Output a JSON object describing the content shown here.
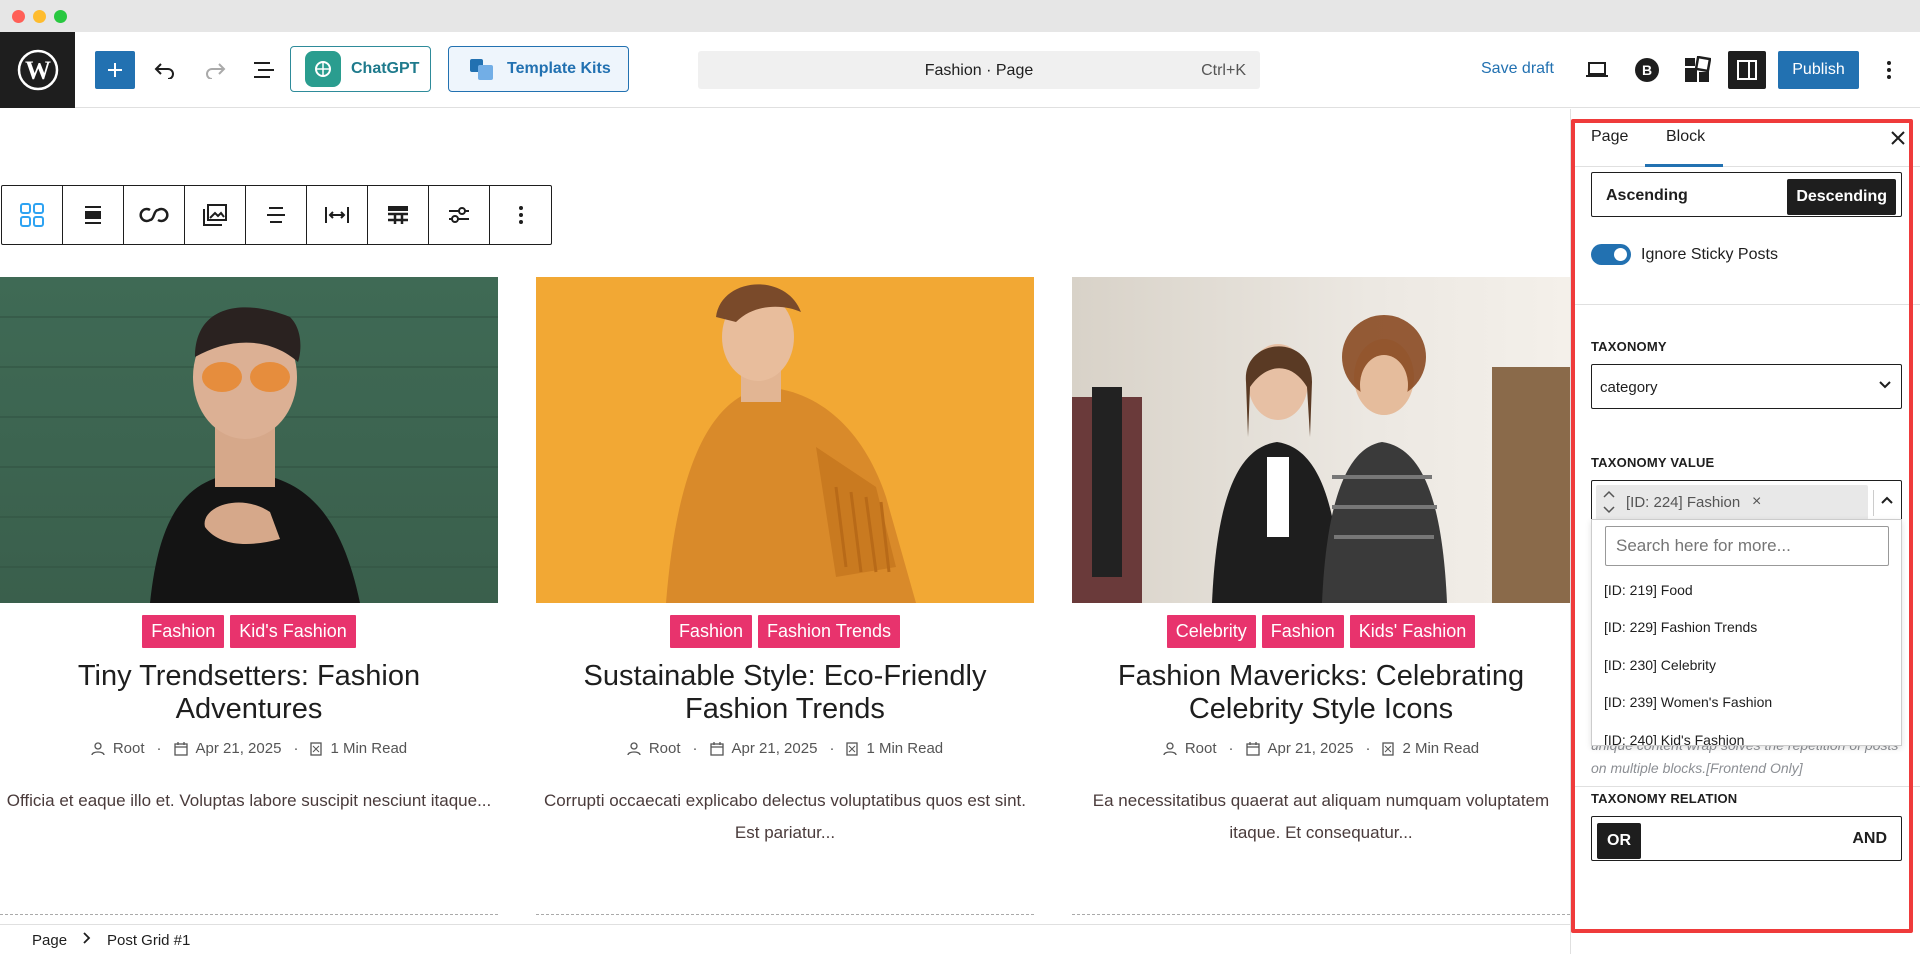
{
  "topbar": {
    "chatgpt_label": "ChatGPT",
    "template_kits_label": "Template Kits",
    "doc_title": "Fashion · Page",
    "shortcut": "Ctrl+K",
    "save_draft": "Save draft",
    "publish": "Publish"
  },
  "posts": [
    {
      "tags": [
        "Fashion",
        "Kid's Fashion"
      ],
      "title": "Tiny Trendsetters: Fashion Adventures",
      "author": "Root",
      "date": "Apr 21, 2025",
      "read": "1 Min Read",
      "excerpt": "Officia et eaque illo et. Voluptas labore suscipit nesciunt itaque..."
    },
    {
      "tags": [
        "Fashion",
        "Fashion Trends"
      ],
      "title": "Sustainable Style: Eco-Friendly Fashion Trends",
      "author": "Root",
      "date": "Apr 21, 2025",
      "read": "1 Min Read",
      "excerpt": "Corrupti occaecati explicabo delectus voluptatibus quos est sint. Est pariatur..."
    },
    {
      "tags": [
        "Celebrity",
        "Fashion",
        "Kids' Fashion"
      ],
      "title": "Fashion Mavericks: Celebrating Celebrity Style Icons",
      "author": "Root",
      "date": "Apr 21, 2025",
      "read": "2 Min Read",
      "excerpt": "Ea necessitatibus quaerat aut aliquam numquam voluptatem itaque. Et consequatur..."
    }
  ],
  "breadcrumb": [
    "Page",
    "Post Grid #1"
  ],
  "sidebar": {
    "tabs": [
      "Page",
      "Block"
    ],
    "order": {
      "ascending": "Ascending",
      "descending": "Descending"
    },
    "ignore_sticky": "Ignore Sticky Posts",
    "taxonomy_label": "TAXONOMY",
    "taxonomy_value": "category",
    "taxonomy_value_label": "TAXONOMY VALUE",
    "selected_chip": "[ID: 224] Fashion",
    "search_placeholder": "Search here for more...",
    "options": [
      "[ID: 219] Food",
      "[ID: 229] Fashion Trends",
      "[ID: 230] Celebrity",
      "[ID: 239] Women's Fashion",
      "[ID: 240] Kid's Fashion"
    ],
    "help_text": "unique content wrap solves the repetition of posts on multiple blocks.[Frontend Only]",
    "relation_label": "TAXONOMY RELATION",
    "relation": {
      "or": "OR",
      "and": "AND"
    }
  },
  "colors": {
    "accent": "#2271b1",
    "tag": "#e8336d",
    "highlight": "#ef3b3b"
  }
}
